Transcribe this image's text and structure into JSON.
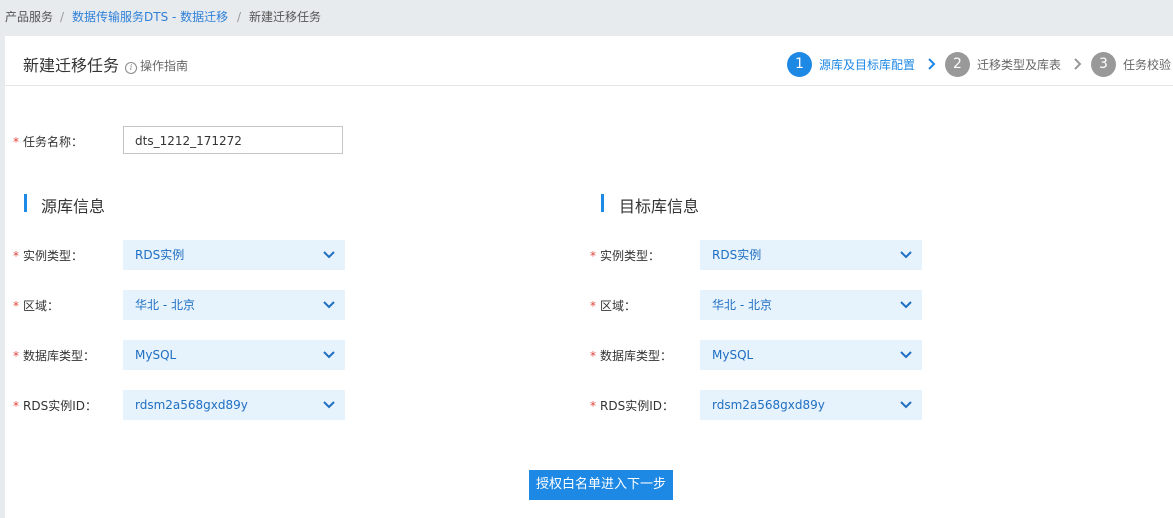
{
  "breadcrumb": {
    "item1": "产品服务",
    "sep": "/",
    "item2": "数据传输服务DTS - 数据迁移",
    "item3": "新建迁移任务"
  },
  "header": {
    "title": "新建迁移任务",
    "guide_label": "操作指南",
    "steps": [
      {
        "num": "1",
        "label": "源库及目标库配置"
      },
      {
        "num": "2",
        "label": "迁移类型及库表"
      },
      {
        "num": "3",
        "label": "任务校验"
      }
    ]
  },
  "colors": {
    "accent": "#1e88e5",
    "step_inactive": "#999999",
    "required": "#e0463c"
  },
  "form": {
    "required_mark": "*",
    "task_name_label": "任务名称：",
    "task_name_value": "dts_1212_171272",
    "source": {
      "title": "源库信息",
      "instance_type_label": "实例类型：",
      "instance_type_value": "RDS实例",
      "region_label": "区域：",
      "region_value": "华北 - 北京",
      "db_type_label": "数据库类型：",
      "db_type_value": "MySQL",
      "rds_id_label": "RDS实例ID：",
      "rds_id_value": "rdsm2a568gxd89y"
    },
    "target": {
      "title": "目标库信息",
      "instance_type_label": "实例类型：",
      "instance_type_value": "RDS实例",
      "region_label": "区域：",
      "region_value": "华北 - 北京",
      "db_type_label": "数据库类型：",
      "db_type_value": "MySQL",
      "rds_id_label": "RDS实例ID：",
      "rds_id_value": "rdsm2a568gxd89y"
    },
    "submit_label": "授权白名单进入下一步"
  }
}
